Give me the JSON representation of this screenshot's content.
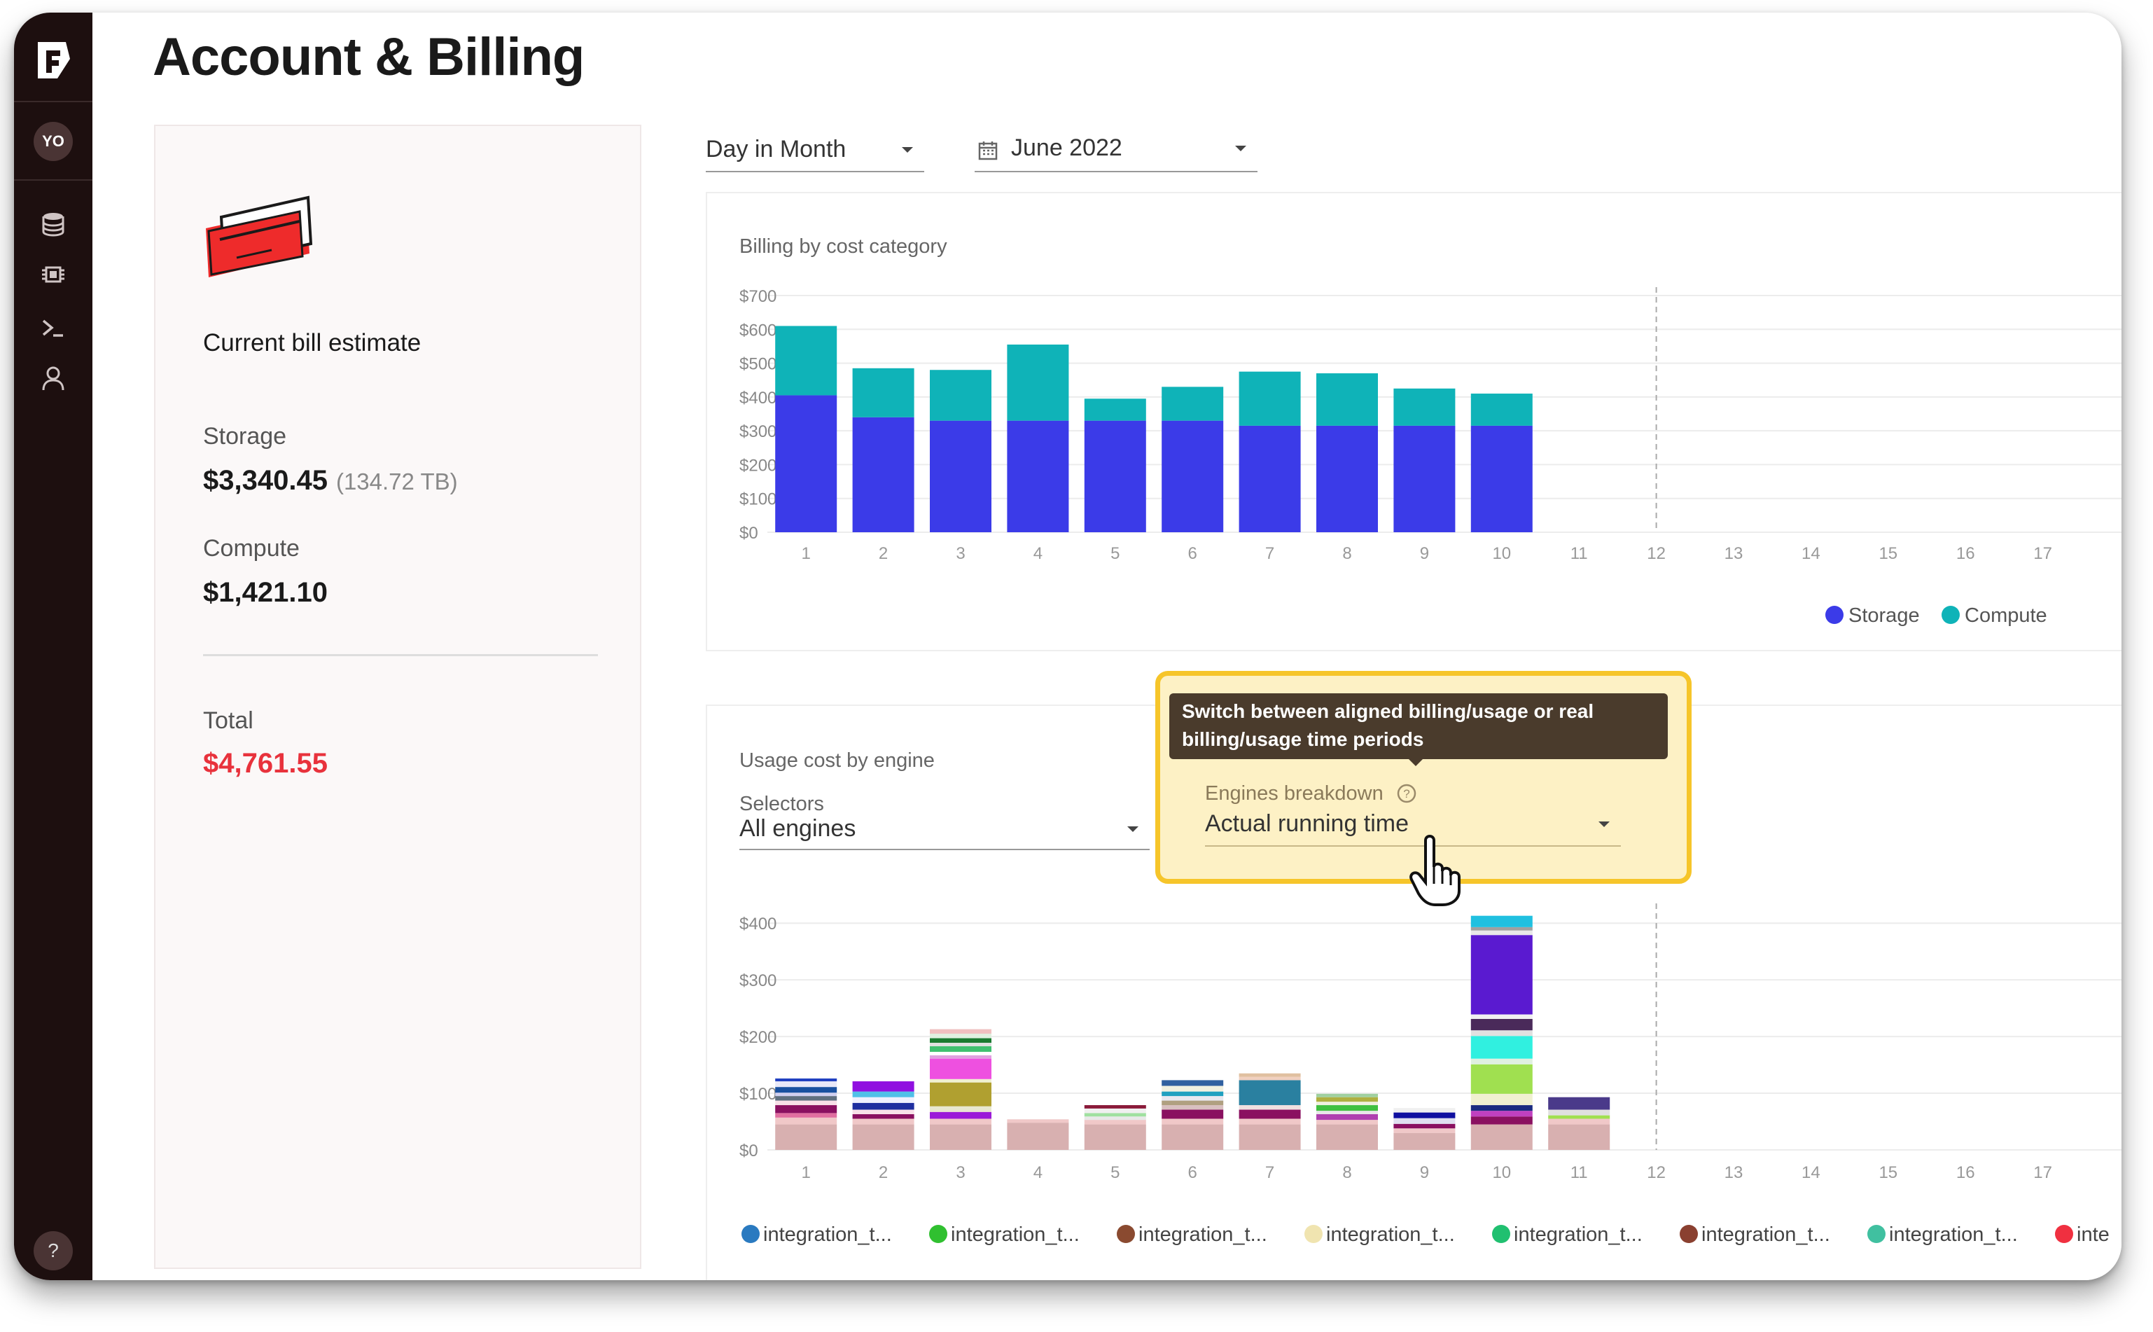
{
  "app": {
    "avatar_initials": "YO",
    "help_label": "?"
  },
  "header": {
    "title": "Account & Billing"
  },
  "bill": {
    "heading": "Current bill estimate",
    "storage_label": "Storage",
    "storage_value": "$3,340.45",
    "storage_size": "(134.72 TB)",
    "compute_label": "Compute",
    "compute_value": "$1,421.10",
    "total_label": "Total",
    "total_value": "$4,761.55",
    "total_color": "#e8323c"
  },
  "filters": {
    "period": "Day in Month",
    "month": "June 2022"
  },
  "billing_panel": {
    "title": "Billing by cost category"
  },
  "usage_panel": {
    "title": "Usage cost by engine",
    "selectors_label": "Selectors",
    "selectors_value": "All engines",
    "breakdown_label": "Engines breakdown",
    "breakdown_value": "Actual running time",
    "tooltip": "Switch between aligned billing/usage or real billing/usage time periods"
  },
  "colors": {
    "storage": "#3b3be8",
    "compute": "#0fb3b8",
    "highlight": "#f6c52a",
    "accent": "#e8323c"
  },
  "icons": [
    "firebolt-logo-icon",
    "database-icon",
    "engine-chip-icon",
    "terminal-icon",
    "user-icon",
    "help-icon",
    "credit-card-icon",
    "calendar-icon",
    "question-circle-icon",
    "hand-cursor-icon"
  ],
  "chart_data": [
    {
      "type": "bar",
      "stacked": true,
      "title": "Billing by cost category",
      "categories": [
        "1",
        "2",
        "3",
        "4",
        "5",
        "6",
        "7",
        "8",
        "9",
        "10",
        "11",
        "12",
        "13",
        "14",
        "15",
        "16",
        "17"
      ],
      "y_ticks": [
        "$0",
        "$100",
        "$200",
        "$300",
        "$400",
        "$500",
        "$600",
        "$700"
      ],
      "ylim": [
        0,
        700
      ],
      "series": [
        {
          "name": "Storage",
          "color": "#3b3be8",
          "values": [
            405,
            340,
            330,
            330,
            330,
            330,
            315,
            315,
            315,
            315
          ]
        },
        {
          "name": "Compute",
          "color": "#0fb3b8",
          "values": [
            205,
            145,
            150,
            225,
            65,
            100,
            160,
            155,
            110,
            95
          ]
        }
      ],
      "marker_x": "12",
      "legend": "bottom-right",
      "grid": true
    },
    {
      "type": "bar",
      "stacked": true,
      "title": "Usage cost by engine",
      "categories": [
        "1",
        "2",
        "3",
        "4",
        "5",
        "6",
        "7",
        "8",
        "9",
        "10",
        "11",
        "12",
        "13",
        "14",
        "15",
        "16",
        "17"
      ],
      "y_ticks": [
        "$0",
        "$100",
        "$200",
        "$300",
        "$400"
      ],
      "ylim": [
        0,
        420
      ],
      "segments": [
        [
          [
            45,
            "#d8b0b0"
          ],
          [
            12,
            "#f0c8c8"
          ],
          [
            8,
            "#e06fa0"
          ],
          [
            14,
            "#8a1060"
          ],
          [
            8,
            "#f8e0e8"
          ],
          [
            8,
            "#607080"
          ],
          [
            6,
            "#d0d0f0"
          ],
          [
            10,
            "#1850a0"
          ],
          [
            10,
            "#e8e8f8"
          ],
          [
            5,
            "#2040c0"
          ]
        ],
        [
          [
            45,
            "#d8b0b0"
          ],
          [
            10,
            "#f0c8c8"
          ],
          [
            8,
            "#8a1060"
          ],
          [
            8,
            "#f8e0e8"
          ],
          [
            12,
            "#1e2ea0"
          ],
          [
            10,
            "#f0f0ff"
          ],
          [
            10,
            "#50c0e8"
          ],
          [
            18,
            "#9010e0"
          ]
        ],
        [
          [
            45,
            "#d8b0b0"
          ],
          [
            10,
            "#f0c8c8"
          ],
          [
            12,
            "#9b1bd8"
          ],
          [
            10,
            "#e8e8d0"
          ],
          [
            42,
            "#b0a030"
          ],
          [
            6,
            "#f0f0d0"
          ],
          [
            36,
            "#ee50e0"
          ],
          [
            6,
            "#e0a0e0"
          ],
          [
            6,
            "#ffffff"
          ],
          [
            10,
            "#40c070"
          ],
          [
            6,
            "#e0e0e0"
          ],
          [
            8,
            "#1a7a30"
          ],
          [
            8,
            "#e0f0e0"
          ],
          [
            8,
            "#f0c0c0"
          ]
        ],
        [
          [
            48,
            "#d8b0b0"
          ],
          [
            6,
            "#f0c8c8"
          ]
        ],
        [
          [
            45,
            "#d8b0b0"
          ],
          [
            8,
            "#f0c8c8"
          ],
          [
            6,
            "#e8e8e8"
          ],
          [
            6,
            "#a0e0a0"
          ],
          [
            8,
            "#f0f0f0"
          ],
          [
            6,
            "#8a1a3a"
          ]
        ],
        [
          [
            45,
            "#d8b0b0"
          ],
          [
            10,
            "#f0c8c8"
          ],
          [
            16,
            "#8a1060"
          ],
          [
            8,
            "#d8c0c0"
          ],
          [
            8,
            "#b0a080"
          ],
          [
            8,
            "#e8e8f0"
          ],
          [
            8,
            "#20a0c0"
          ],
          [
            10,
            "#f0f0e0"
          ],
          [
            10,
            "#3060a0"
          ]
        ],
        [
          [
            45,
            "#d8b0b0"
          ],
          [
            10,
            "#f0c8c8"
          ],
          [
            16,
            "#8a1060"
          ],
          [
            8,
            "#f0e0e0"
          ],
          [
            44,
            "#2a80a0"
          ],
          [
            6,
            "#f0d0c0"
          ],
          [
            6,
            "#e0c0a0"
          ]
        ],
        [
          [
            45,
            "#d8b0b0"
          ],
          [
            8,
            "#f0c8c8"
          ],
          [
            10,
            "#b040b0"
          ],
          [
            6,
            "#e8e8e8"
          ],
          [
            10,
            "#40c040"
          ],
          [
            6,
            "#f0f0e0"
          ],
          [
            8,
            "#b0b040"
          ],
          [
            6,
            "#a0d0a0"
          ]
        ],
        [
          [
            30,
            "#d8b0b0"
          ],
          [
            8,
            "#f0c8c8"
          ],
          [
            8,
            "#8a1060"
          ],
          [
            10,
            "#e0e0f0"
          ],
          [
            10,
            "#1010a0"
          ],
          [
            8,
            "#f0f0f0"
          ]
        ],
        [
          [
            45,
            "#d8b0b0"
          ],
          [
            14,
            "#8a1060"
          ],
          [
            10,
            "#c040c0"
          ],
          [
            10,
            "#1a2a80"
          ],
          [
            20,
            "#f0f0d0"
          ],
          [
            52,
            "#a0e050"
          ],
          [
            10,
            "#e0f0e0"
          ],
          [
            40,
            "#30f0e0"
          ],
          [
            10,
            "#e0e0e0"
          ],
          [
            20,
            "#4a2a5a"
          ],
          [
            8,
            "#f0f0f0"
          ],
          [
            140,
            "#5a1ad0"
          ],
          [
            8,
            "#e8e8e8"
          ],
          [
            6,
            "#a0a0a0"
          ],
          [
            20,
            "#20c0e0"
          ]
        ],
        [
          [
            45,
            "#d8b0b0"
          ],
          [
            10,
            "#f0c8c8"
          ],
          [
            6,
            "#a0e050"
          ],
          [
            10,
            "#e0e0e0"
          ],
          [
            22,
            "#4a3a8a"
          ]
        ]
      ],
      "legend_entries": [
        "integration_t...",
        "integration_t...",
        "integration_t...",
        "integration_t...",
        "integration_t...",
        "integration_t...",
        "integration_t...",
        "inte"
      ],
      "legend_colors": [
        "#2a7ac0",
        "#30c030",
        "#8a4a30",
        "#f0e4b0",
        "#20c070",
        "#8a4030",
        "#40c0a0",
        "#f03040"
      ],
      "marker_x": "12",
      "legend": "bottom",
      "grid": true
    }
  ]
}
